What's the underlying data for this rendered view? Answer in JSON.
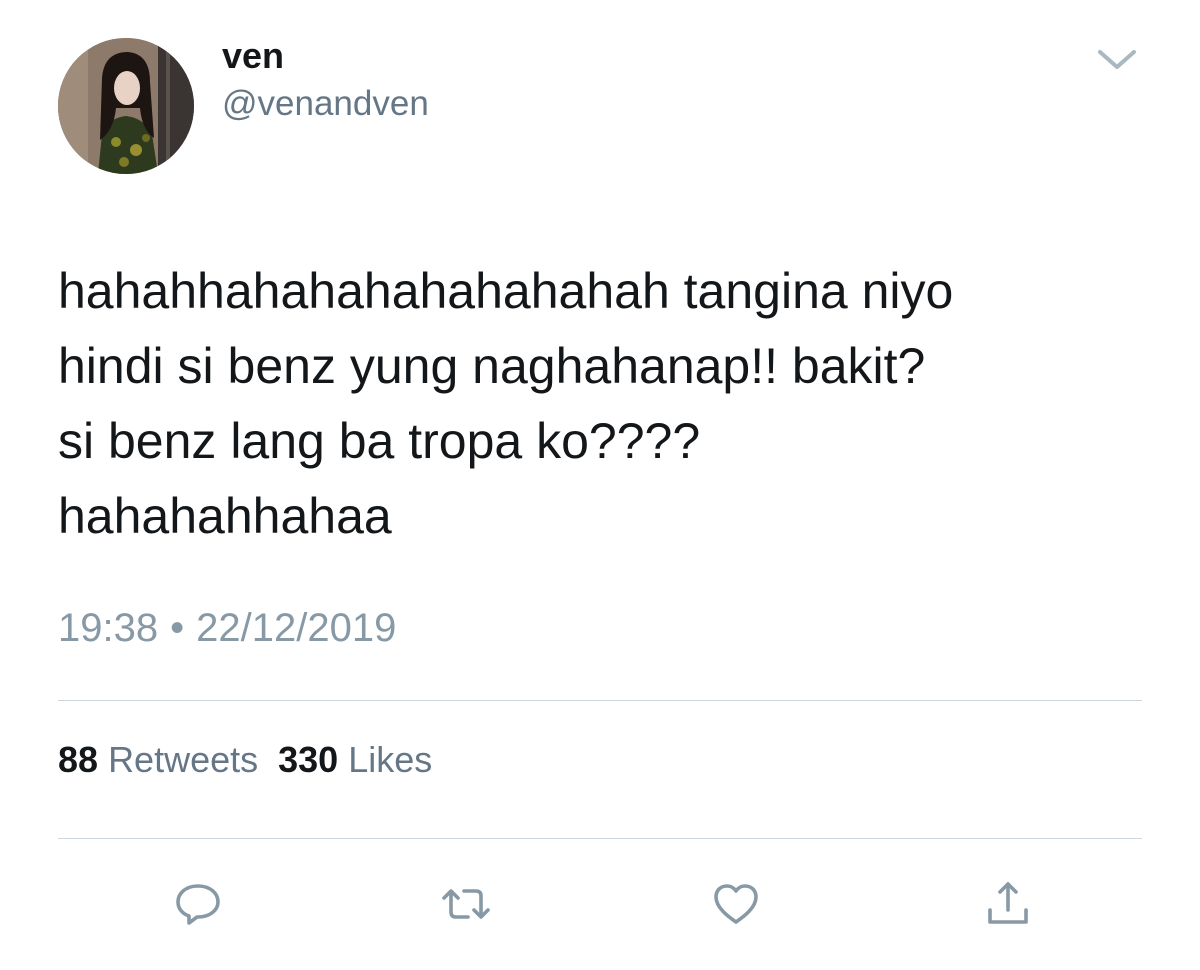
{
  "tweet": {
    "author": {
      "display_name": "ven",
      "handle": "@venandven"
    },
    "text": "hahahhahahahahahahahah tangina niyo\nhindi si benz yung naghahanap!! bakit?\nsi benz lang ba tropa ko????\nhahahahhahaa",
    "time": "19:38",
    "separator": "•",
    "date": "22/12/2019"
  },
  "stats": {
    "retweets_count": "88",
    "retweets_label": "Retweets",
    "likes_count": "330",
    "likes_label": "Likes"
  },
  "actions": {
    "icons": [
      "reply-icon",
      "retweet-icon",
      "like-icon",
      "share-icon"
    ]
  },
  "colors": {
    "text": "#14171a",
    "secondary": "#657786",
    "meta": "#8899a6",
    "icon": "#8899a6",
    "divider": "#cfd6dc"
  }
}
